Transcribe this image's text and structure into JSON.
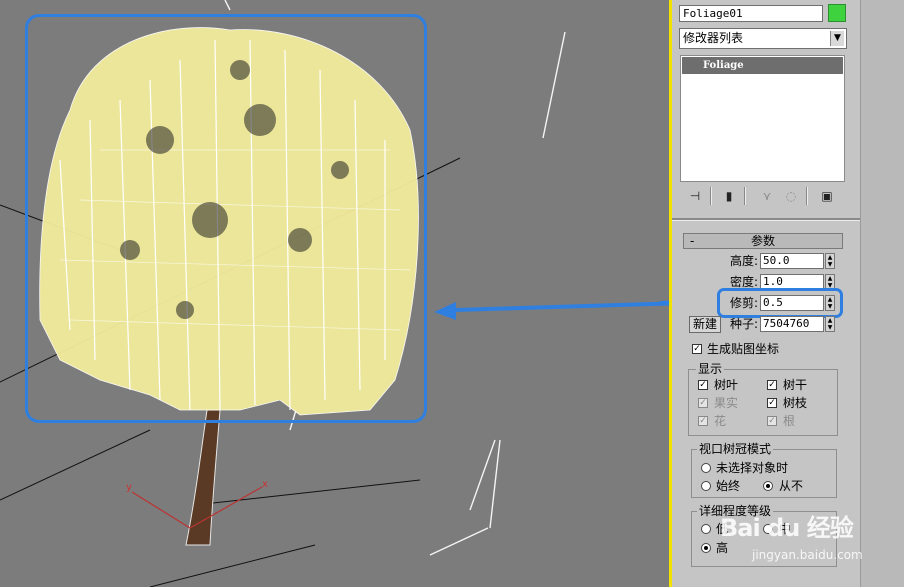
{
  "object": {
    "name": "Foliage01",
    "color": "#3fd23f"
  },
  "modifier_list": {
    "value": "修改器列表"
  },
  "stack": {
    "items": [
      "Foliage"
    ]
  },
  "stack_tools": [
    "pin-stack-icon",
    "show-end-result-icon",
    "make-unique-icon",
    "remove-modifier-icon",
    "configure-modifier-sets-icon"
  ],
  "params": {
    "header": "参数",
    "collapse": "-",
    "height": {
      "label": "高度:",
      "value": "50.0"
    },
    "density": {
      "label": "密度:",
      "value": "1.0"
    },
    "pruning": {
      "label": "修剪:",
      "value": "0.5"
    },
    "seed": {
      "label": "种子:",
      "value": "7504760",
      "new_button": "新建"
    },
    "gen_mapping": {
      "label": "生成贴图坐标",
      "checked": true
    }
  },
  "display": {
    "title": "显示",
    "items": [
      {
        "label": "树叶",
        "checked": true,
        "enabled": true
      },
      {
        "label": "树干",
        "checked": true,
        "enabled": true
      },
      {
        "label": "果实",
        "checked": true,
        "enabled": false
      },
      {
        "label": "树枝",
        "checked": true,
        "enabled": true
      },
      {
        "label": "花",
        "checked": true,
        "enabled": false
      },
      {
        "label": "根",
        "checked": true,
        "enabled": false
      }
    ]
  },
  "canopy_mode": {
    "title": "视口树冠模式",
    "options": [
      "未选择对象时",
      "始终",
      "从不"
    ],
    "selected": "从不"
  },
  "detail_level": {
    "title": "详细程度等级",
    "options": [
      "低",
      "中",
      "高"
    ],
    "selected": "高"
  },
  "axes": {
    "x": "x",
    "y": "y"
  },
  "watermark": {
    "brand": "Bai du 经验",
    "url": "jingyan.baidu.com"
  }
}
